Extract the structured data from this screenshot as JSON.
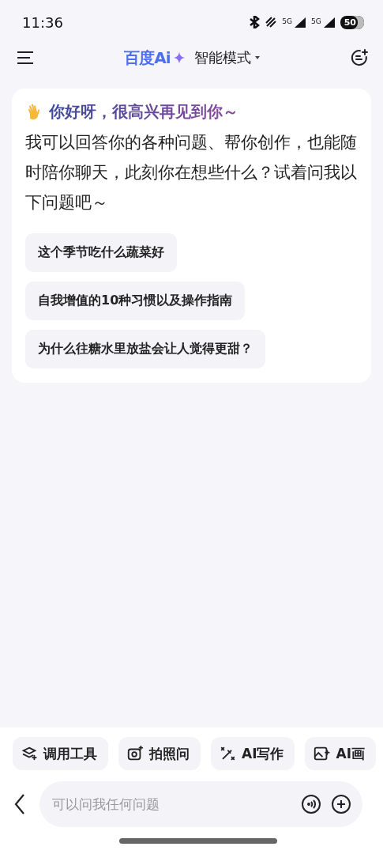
{
  "status_bar": {
    "time": "11:36",
    "network_labels": [
      "5G",
      "5G"
    ],
    "battery": "50"
  },
  "header": {
    "logo": "百度Ai",
    "mode": "智能模式"
  },
  "welcome": {
    "greeting": "你好呀，很高兴再见到你～",
    "intro": "我可以回答你的各种问题、帮你创作，也能随时陪你聊天，此刻你在想些什么？试着问我以下问题吧～",
    "suggestions": [
      "这个季节吃什么蔬菜好",
      "自我增值的10种习惯以及操作指南",
      "为什么往糖水里放盐会让人觉得更甜？"
    ]
  },
  "tools": [
    {
      "kind": "tools",
      "label": "调用工具"
    },
    {
      "kind": "camera",
      "label": "拍照问"
    },
    {
      "kind": "write",
      "label": "AI写作"
    },
    {
      "kind": "image",
      "label": "AI画"
    }
  ],
  "input": {
    "placeholder": "可以问我任何问题"
  }
}
